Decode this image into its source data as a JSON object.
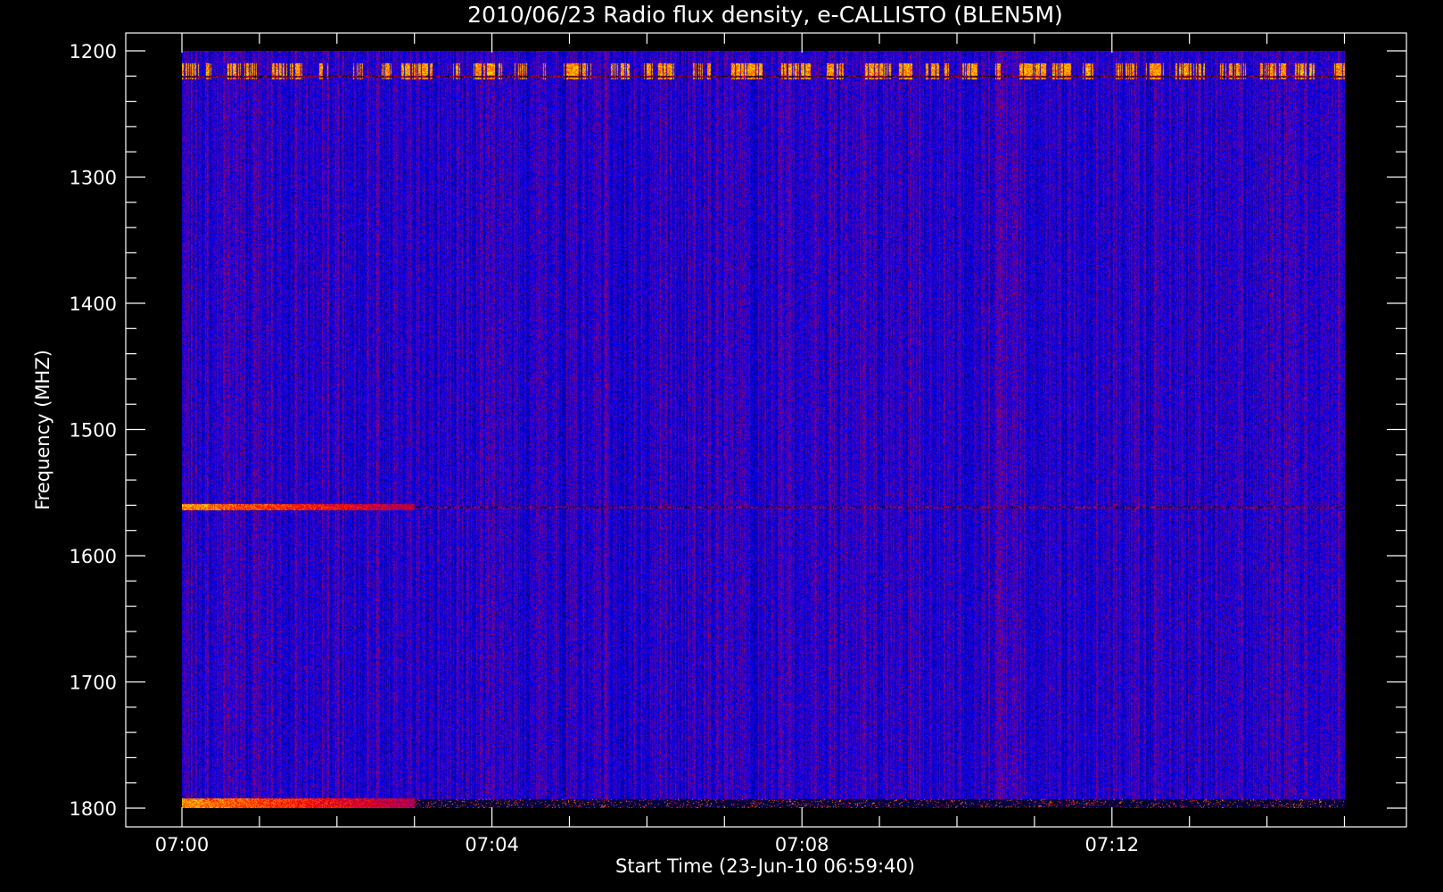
{
  "chart_data": {
    "type": "heatmap",
    "title": "2010/06/23  Radio flux density, e-CALLISTO (BLEN5M)",
    "xlabel": "Start Time (23-Jun-10 06:59:40)",
    "ylabel": "Frequency (MHZ)",
    "x_axis": {
      "unit": "time",
      "range": [
        "06:59:40",
        "07:15:40"
      ],
      "data_range": [
        "07:00",
        "07:15"
      ],
      "ticks": [
        "07:00",
        "07:04",
        "07:08",
        "07:12"
      ]
    },
    "y_axis": {
      "unit": "MHz",
      "range": [
        1200,
        1800
      ],
      "reversed": true,
      "ticks": [
        1200,
        1300,
        1400,
        1500,
        1600,
        1700,
        1800
      ]
    },
    "colormap": [
      "#000000",
      "#0000ff",
      "#ff0000",
      "#ffff00"
    ],
    "background_intensity": "blue",
    "features": [
      {
        "type": "intermittent-bright-band",
        "freq_mhz": [
          1210,
          1222
        ],
        "time": [
          "07:00",
          "07:15"
        ]
      },
      {
        "type": "dark-line",
        "freq_mhz": 1220,
        "time": [
          "07:00",
          "07:15"
        ]
      },
      {
        "type": "bright-band",
        "freq_mhz": [
          1559,
          1563
        ],
        "time": [
          "07:00",
          "07:03"
        ]
      },
      {
        "type": "dark-line",
        "freq_mhz": 1561,
        "time": [
          "07:03",
          "07:15"
        ]
      },
      {
        "type": "bright-band",
        "freq_mhz": [
          1792,
          1800
        ],
        "time": [
          "07:00",
          "07:03"
        ]
      },
      {
        "type": "dark-band",
        "freq_mhz": [
          1793,
          1800
        ],
        "time": [
          "07:03",
          "07:15"
        ]
      }
    ]
  }
}
